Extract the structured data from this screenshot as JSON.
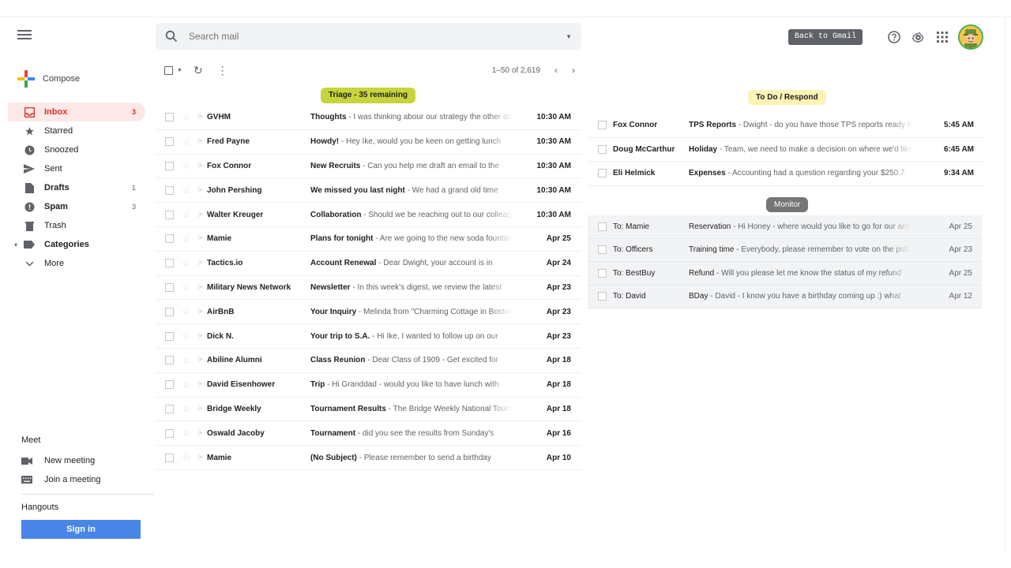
{
  "sidebar": {
    "compose_label": "Compose",
    "items": [
      {
        "name": "inbox",
        "label": "Inbox",
        "count": "3",
        "icon": "inbox-icon"
      },
      {
        "name": "starred",
        "label": "Starred",
        "count": "",
        "icon": "star-icon"
      },
      {
        "name": "snoozed",
        "label": "Snoozed",
        "count": "",
        "icon": "clock-icon"
      },
      {
        "name": "sent",
        "label": "Sent",
        "count": "",
        "icon": "send-icon"
      },
      {
        "name": "drafts",
        "label": "Drafts",
        "count": "1",
        "icon": "draft-icon"
      },
      {
        "name": "spam",
        "label": "Spam",
        "count": "3",
        "icon": "spam-icon"
      },
      {
        "name": "trash",
        "label": "Trash",
        "count": "",
        "icon": "trash-icon"
      },
      {
        "name": "categories",
        "label": "Categories",
        "count": "",
        "icon": "label-icon"
      },
      {
        "name": "more",
        "label": "More",
        "count": "",
        "icon": "chevron-down-icon"
      }
    ],
    "meet": {
      "title": "Meet",
      "new_meeting": "New meeting",
      "join_meeting": "Join a meeting"
    },
    "hangouts": {
      "title": "Hangouts",
      "signin": "Sign in"
    }
  },
  "search": {
    "placeholder": "Search mail"
  },
  "toolbar": {
    "range": "1–50 of 2,619"
  },
  "triage_label": "Triage - 35 remaining",
  "inbox": [
    {
      "sender": "GVHM",
      "subject": "Thoughts",
      "snippet": " - I was thinking abour our strategy the other day",
      "date": "10:30 AM"
    },
    {
      "sender": "Fred Payne",
      "subject": "Howdy!",
      "snippet": " - Hey Ike, would you be keen on getting lunch",
      "date": "10:30 AM"
    },
    {
      "sender": "Fox Connor",
      "subject": "New Recruits",
      "snippet": " - Can you help me draft an email to the",
      "date": "10:30 AM"
    },
    {
      "sender": "John Pershing",
      "subject": "We missed you last night",
      "snippet": " - We had a grand old time",
      "date": "10:30 AM"
    },
    {
      "sender": "Walter Kreuger",
      "subject": "Collaboration",
      "snippet": " - Should we be reaching out to our colleagues",
      "date": "10:30 AM"
    },
    {
      "sender": "Mamie",
      "subject": "Plans for tonight",
      "snippet": " - Are we going to the new soda fountain",
      "date": "Apr 25"
    },
    {
      "sender": "Tactics.io",
      "subject": "Account Renewal",
      "snippet": " - Dear Dwight, your account is in",
      "date": "Apr 24"
    },
    {
      "sender": "Military News Network",
      "subject": "Newsletter",
      "snippet": " - In this week's digest, we review the latest",
      "date": "Apr 23"
    },
    {
      "sender": "AirBnB",
      "subject": "Your Inquiry",
      "snippet": " - Melinda from \"Charming Cottage in Boston",
      "date": "Apr 23"
    },
    {
      "sender": "Dick N.",
      "subject": "Your trip to S.A.",
      "snippet": " - Hi Ike, I wanted to follow up on our",
      "date": "Apr 23"
    },
    {
      "sender": "Abiline Alumni",
      "subject": "Class Reunion",
      "snippet": " - Dear Class of 1909 - Get excited for",
      "date": "Apr 18"
    },
    {
      "sender": "David Eisenhower",
      "subject": "Trip",
      "snippet": " - Hi Granddad - would you like to have lunch with",
      "date": "Apr 18"
    },
    {
      "sender": "Bridge Weekly",
      "subject": "Tournament Results",
      "snippet": " - The Bridge Weekly National Tournament",
      "date": "Apr 18"
    },
    {
      "sender": "Oswald Jacoby",
      "subject": "Tournament",
      "snippet": " - did you see the results from Sunday's",
      "date": "Apr 16"
    },
    {
      "sender": "Mamie",
      "subject": "(No Subject)",
      "snippet": " - Please remember to send a birthday",
      "date": "Apr 10"
    }
  ],
  "right": {
    "back_button": "Back to Gmail",
    "todo_label": "To Do / Respond",
    "todo": [
      {
        "sender": "Fox Connor",
        "subject": "TPS Reports",
        "snippet": " - Dwight - do you have those TPS reports ready for",
        "date": "5:45 AM"
      },
      {
        "sender": "Doug McCarthur",
        "subject": "Holiday",
        "snippet": " - Team, we need to make a decision on where we'd like",
        "date": "6:45 AM"
      },
      {
        "sender": "Eli Helmick",
        "subject": "Expenses",
        "snippet": " - Accounting had a question regarding your $250.7",
        "date": "9:34 AM"
      }
    ],
    "monitor_label": "Monitor",
    "monitor": [
      {
        "sender": "To: Mamie",
        "subject": "Reservation",
        "snippet": " - Hi Honey - where would you like to go for our anniversary",
        "date": "Apr 25"
      },
      {
        "sender": "To: Officers",
        "subject": "Training time",
        "snippet": " - Everybody, please remember to vote on the poll",
        "date": "Apr 23"
      },
      {
        "sender": "To: BestBuy",
        "subject": "Refund",
        "snippet": " - Will you please let me know the status of my refund",
        "date": "Apr 25"
      },
      {
        "sender": "To: David",
        "subject": "BDay",
        "snippet": " - David - I know you have a birthday coming up :) what",
        "date": "Apr 12"
      }
    ]
  },
  "colors": {
    "inbox_active": "#d93025",
    "triage_badge": "#c8d43c",
    "todo_badge": "#fdf3b4",
    "monitor_badge": "#757575",
    "back_button": "#5f6368",
    "signin": "#4a86e8"
  }
}
